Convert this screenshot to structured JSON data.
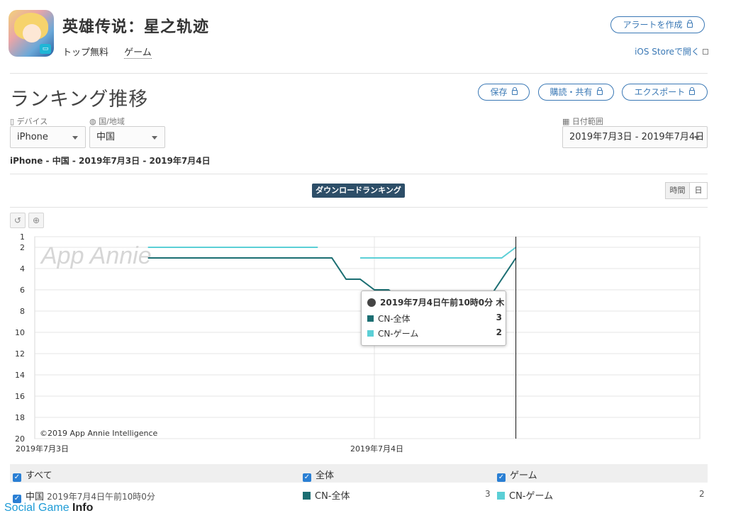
{
  "app": {
    "name": "英雄传说：星之轨迹",
    "chart": "トップ無料",
    "genre": "ゲーム",
    "alert_button": "アラートを作成",
    "ios_store_link": "iOS Storeで開く"
  },
  "page": {
    "title": "ランキング推移",
    "save_button": "保存",
    "subscribe_button": "購読・共有",
    "export_button": "エクスポート"
  },
  "filters": {
    "device_label": "デバイス",
    "device_value": "iPhone",
    "region_label": "国/地域",
    "region_value": "中国",
    "date_label": "日付範囲",
    "date_value": "2019年7月3日 - 2019年7月4日"
  },
  "subtitle": "iPhone - 中国 - 2019年7月3日 - 2019年7月4日",
  "chart_header": {
    "tag": "ダウンロードランキング",
    "granularity": [
      "時間",
      "日"
    ]
  },
  "chart_data": {
    "type": "line",
    "x": [
      "2019-07-03T00:00",
      "2019-07-03T01:00",
      "2019-07-03T02:00",
      "2019-07-03T03:00",
      "2019-07-03T04:00",
      "2019-07-03T05:00",
      "2019-07-03T06:00",
      "2019-07-03T07:00",
      "2019-07-03T08:00",
      "2019-07-03T09:00",
      "2019-07-03T10:00",
      "2019-07-03T11:00",
      "2019-07-03T12:00",
      "2019-07-03T13:00",
      "2019-07-03T14:00",
      "2019-07-03T15:00",
      "2019-07-03T16:00",
      "2019-07-03T17:00",
      "2019-07-03T18:00",
      "2019-07-03T19:00",
      "2019-07-03T20:00",
      "2019-07-03T21:00",
      "2019-07-03T22:00",
      "2019-07-03T23:00",
      "2019-07-04T00:00",
      "2019-07-04T01:00",
      "2019-07-04T02:00",
      "2019-07-04T03:00",
      "2019-07-04T04:00",
      "2019-07-04T05:00",
      "2019-07-04T06:00",
      "2019-07-04T07:00",
      "2019-07-04T08:00",
      "2019-07-04T09:00",
      "2019-07-04T10:00"
    ],
    "series": [
      {
        "name": "CN-全体",
        "color": "#1b6e72",
        "values": [
          null,
          null,
          null,
          null,
          null,
          null,
          null,
          null,
          3,
          3,
          3,
          3,
          3,
          3,
          3,
          3,
          3,
          3,
          3,
          3,
          3,
          3,
          5,
          5,
          6,
          6,
          7,
          7,
          7,
          7,
          7,
          7,
          7,
          5,
          3
        ]
      },
      {
        "name": "CN-ゲーム",
        "color": "#5bcfd6",
        "values": [
          null,
          null,
          null,
          null,
          null,
          null,
          null,
          null,
          2,
          2,
          2,
          2,
          2,
          2,
          2,
          2,
          2,
          2,
          2,
          2,
          2,
          null,
          null,
          3,
          3,
          3,
          3,
          3,
          3,
          3,
          3,
          3,
          3,
          3,
          2
        ]
      }
    ],
    "yticks": [
      1,
      2,
      4,
      6,
      8,
      10,
      12,
      14,
      16,
      18,
      20
    ],
    "y_inverted": true,
    "ylim": [
      1,
      20
    ],
    "xtick_labels": [
      "2019年7月3日",
      "2019年7月4日"
    ],
    "grid": true,
    "watermark": "App Annie",
    "copyright": "©2019 App Annie Intelligence",
    "hover_index": 34
  },
  "tooltip": {
    "title": "2019年7月4日午前10時0分 木",
    "rows": [
      {
        "label": "CN-全体",
        "value": "3"
      },
      {
        "label": "CN-ゲーム",
        "value": "2"
      }
    ]
  },
  "legend": {
    "all": "すべて",
    "overall": "全体",
    "game": "ゲーム"
  },
  "data_row": {
    "region": "中国",
    "datetime": "2019年7月4日午前10時0分",
    "overall_label": "CN-全体",
    "overall_value": "3",
    "game_label": "CN-ゲーム",
    "game_value": "2"
  },
  "footer_watermark": {
    "part1": "Social Game ",
    "part2": "Info"
  }
}
